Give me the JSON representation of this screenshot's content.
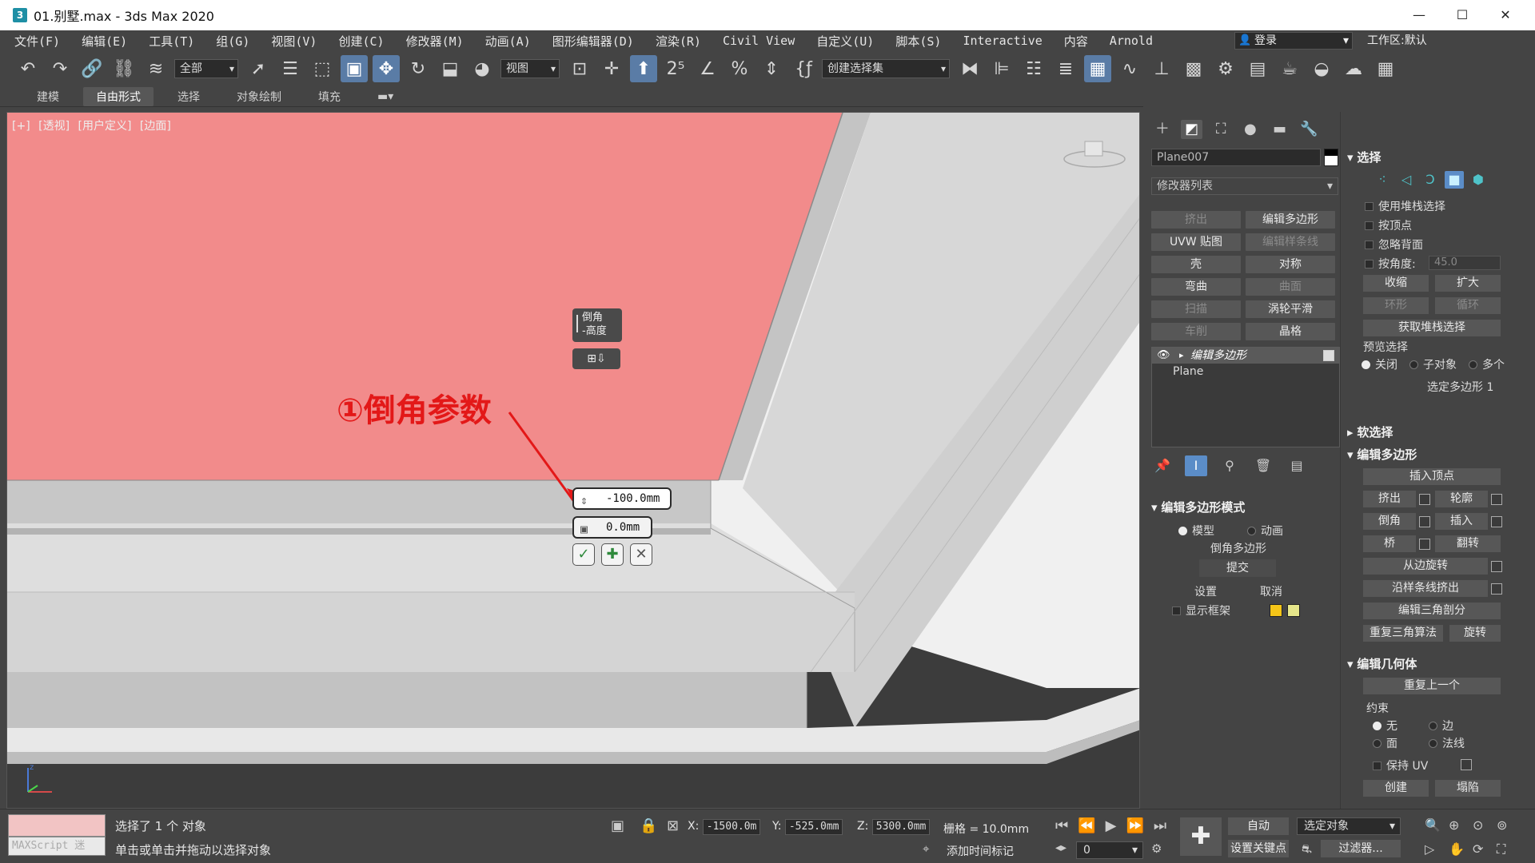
{
  "window": {
    "title": "01.别墅.max - 3ds Max 2020",
    "app_icon": "3",
    "minimize": "—",
    "maximize": "☐",
    "close": "✕"
  },
  "menu": [
    "文件(F)",
    "编辑(E)",
    "工具(T)",
    "组(G)",
    "视图(V)",
    "创建(C)",
    "修改器(M)",
    "动画(A)",
    "图形编辑器(D)",
    "渲染(R)",
    "Civil View",
    "自定义(U)",
    "脚本(S)",
    "Interactive",
    "内容",
    "Arnold"
  ],
  "login": "登录",
  "workspace": "工作区:默认",
  "toolbar": {
    "selection_filter": "全部",
    "reference_coord": "视图",
    "named_selection": "创建选择集"
  },
  "ribbon_tabs": [
    "建模",
    "自由形式",
    "选择",
    "对象绘制",
    "填充"
  ],
  "ribbon_active": "自由形式",
  "viewport": {
    "labels": [
      "[+]",
      "[透视]",
      "[用户定义]",
      "[边面]"
    ],
    "colors": {
      "selected_face": "#f28b8b",
      "geometry": "#e6e6e6",
      "background": "#3c3c3c"
    }
  },
  "annotation": "①倒角参数",
  "caddy": {
    "title_line1": "倒角",
    "title_line2": "-高度",
    "type_icon": "⊞⇩",
    "height_value": "-100.0mm",
    "outline_value": "0.0mm",
    "ok_icon": "✓",
    "apply_icon": "✚",
    "cancel_icon": "✕"
  },
  "command_panel": {
    "object_name": "Plane007",
    "modifier_list": "修改器列表",
    "modifier_buttons": [
      {
        "label": "挤出",
        "dim": true
      },
      {
        "label": "编辑多边形",
        "dim": false
      },
      {
        "label": "UVW 贴图",
        "dim": false
      },
      {
        "label": "编辑样条线",
        "dim": true
      },
      {
        "label": "壳",
        "dim": false
      },
      {
        "label": "对称",
        "dim": false
      },
      {
        "label": "弯曲",
        "dim": false
      },
      {
        "label": "曲面",
        "dim": true
      },
      {
        "label": "扫描",
        "dim": true
      },
      {
        "label": "涡轮平滑",
        "dim": false
      },
      {
        "label": "车削",
        "dim": true
      },
      {
        "label": "晶格",
        "dim": false
      }
    ],
    "stack": {
      "active": "编辑多边形",
      "base": "Plane"
    },
    "edit_poly_mode": {
      "header": "编辑多边形模式",
      "model": "模型",
      "animate": "动画",
      "operation": "倒角多边形",
      "commit": "提交",
      "settings": "设置",
      "cancel": "取消",
      "show_cage": "显示框架",
      "cage_color1": "#f5c518",
      "cage_color2": "#e6e68a"
    }
  },
  "right_panel": {
    "selection": {
      "header": "选择",
      "use_stack": "使用堆栈选择",
      "by_vertex": "按顶点",
      "ignore_back": "忽略背面",
      "by_angle": "按角度:",
      "angle_value": "45.0",
      "shrink": "收缩",
      "grow": "扩大",
      "ring": "环形",
      "loop": "循环",
      "get_stack": "获取堆栈选择",
      "preview": "预览选择",
      "off": "关闭",
      "subobj": "子对象",
      "multi": "多个",
      "selected": "选定多边形 1"
    },
    "soft_selection": "软选择",
    "edit_polygons": {
      "header": "编辑多边形",
      "insert_vertex": "插入顶点",
      "extrude": "挤出",
      "outline": "轮廓",
      "bevel": "倒角",
      "inset": "插入",
      "bridge": "桥",
      "flip": "翻转",
      "hinge": "从边旋转",
      "extrude_spline": "沿样条线挤出",
      "edit_tri": "编辑三角剖分",
      "retriangulate": "重复三角算法",
      "turn": "旋转"
    },
    "edit_geometry": {
      "header": "编辑几何体",
      "repeat_last": "重复上一个",
      "constraints": "约束",
      "none": "无",
      "edge": "边",
      "face": "面",
      "normal": "法线",
      "preserve_uv": "保持 UV",
      "create": "创建",
      "collapse": "塌陷"
    }
  },
  "status": {
    "maxscript": "MAXScript 迷",
    "line1": "选择了 1 个 对象",
    "line2": "单击或单击并拖动以选择对象",
    "x": "-1500.0m",
    "y": "-525.0mm",
    "z": "5300.0mm",
    "grid": "栅格 = 10.0mm",
    "add_time_tag": "添加时间标记",
    "frame": "0",
    "auto": "自动",
    "set_key": "设置关键点",
    "selected_object": "选定对象",
    "filters": "过滤器..."
  }
}
